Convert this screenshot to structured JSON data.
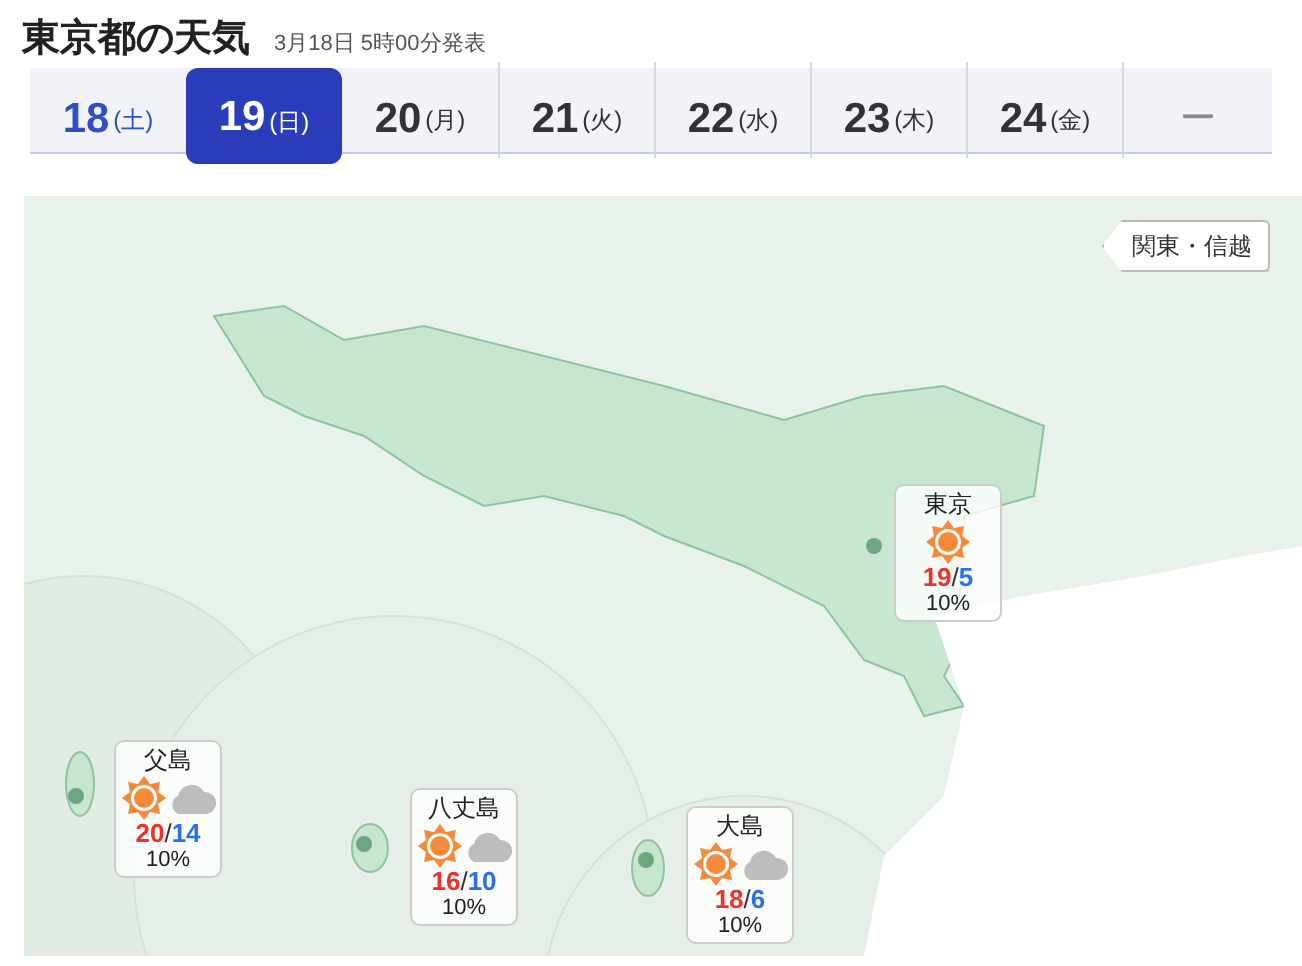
{
  "title": "東京都の天気",
  "issued": "3月18日 5時00分発表",
  "days": [
    {
      "day": "18",
      "weekday": "(土)",
      "kind": "sat",
      "selected": false
    },
    {
      "day": "19",
      "weekday": "(日)",
      "kind": "sun",
      "selected": true
    },
    {
      "day": "20",
      "weekday": "(月)",
      "kind": "weekday",
      "selected": false
    },
    {
      "day": "21",
      "weekday": "(火)",
      "kind": "weekday",
      "selected": false
    },
    {
      "day": "22",
      "weekday": "(水)",
      "kind": "weekday",
      "selected": false
    },
    {
      "day": "23",
      "weekday": "(木)",
      "kind": "weekday",
      "selected": false
    },
    {
      "day": "24",
      "weekday": "(金)",
      "kind": "weekday",
      "selected": false
    },
    {
      "day": "ー",
      "kind": "more",
      "selected": false
    }
  ],
  "region_link": "関東・信越",
  "stations": [
    {
      "name": "東京",
      "kind": "sunny",
      "high": "19",
      "separator": "/",
      "low": "5",
      "pop": "10%"
    },
    {
      "name": "父島",
      "kind": "sunny_cloudy",
      "high": "20",
      "separator": "/",
      "low": "14",
      "pop": "10%"
    },
    {
      "name": "八丈島",
      "kind": "sunny_cloudy",
      "high": "16",
      "separator": "/",
      "low": "10",
      "pop": "10%"
    },
    {
      "name": "大島",
      "kind": "sunny_cloudy",
      "high": "18",
      "separator": "/",
      "low": "6",
      "pop": "10%"
    }
  ]
}
